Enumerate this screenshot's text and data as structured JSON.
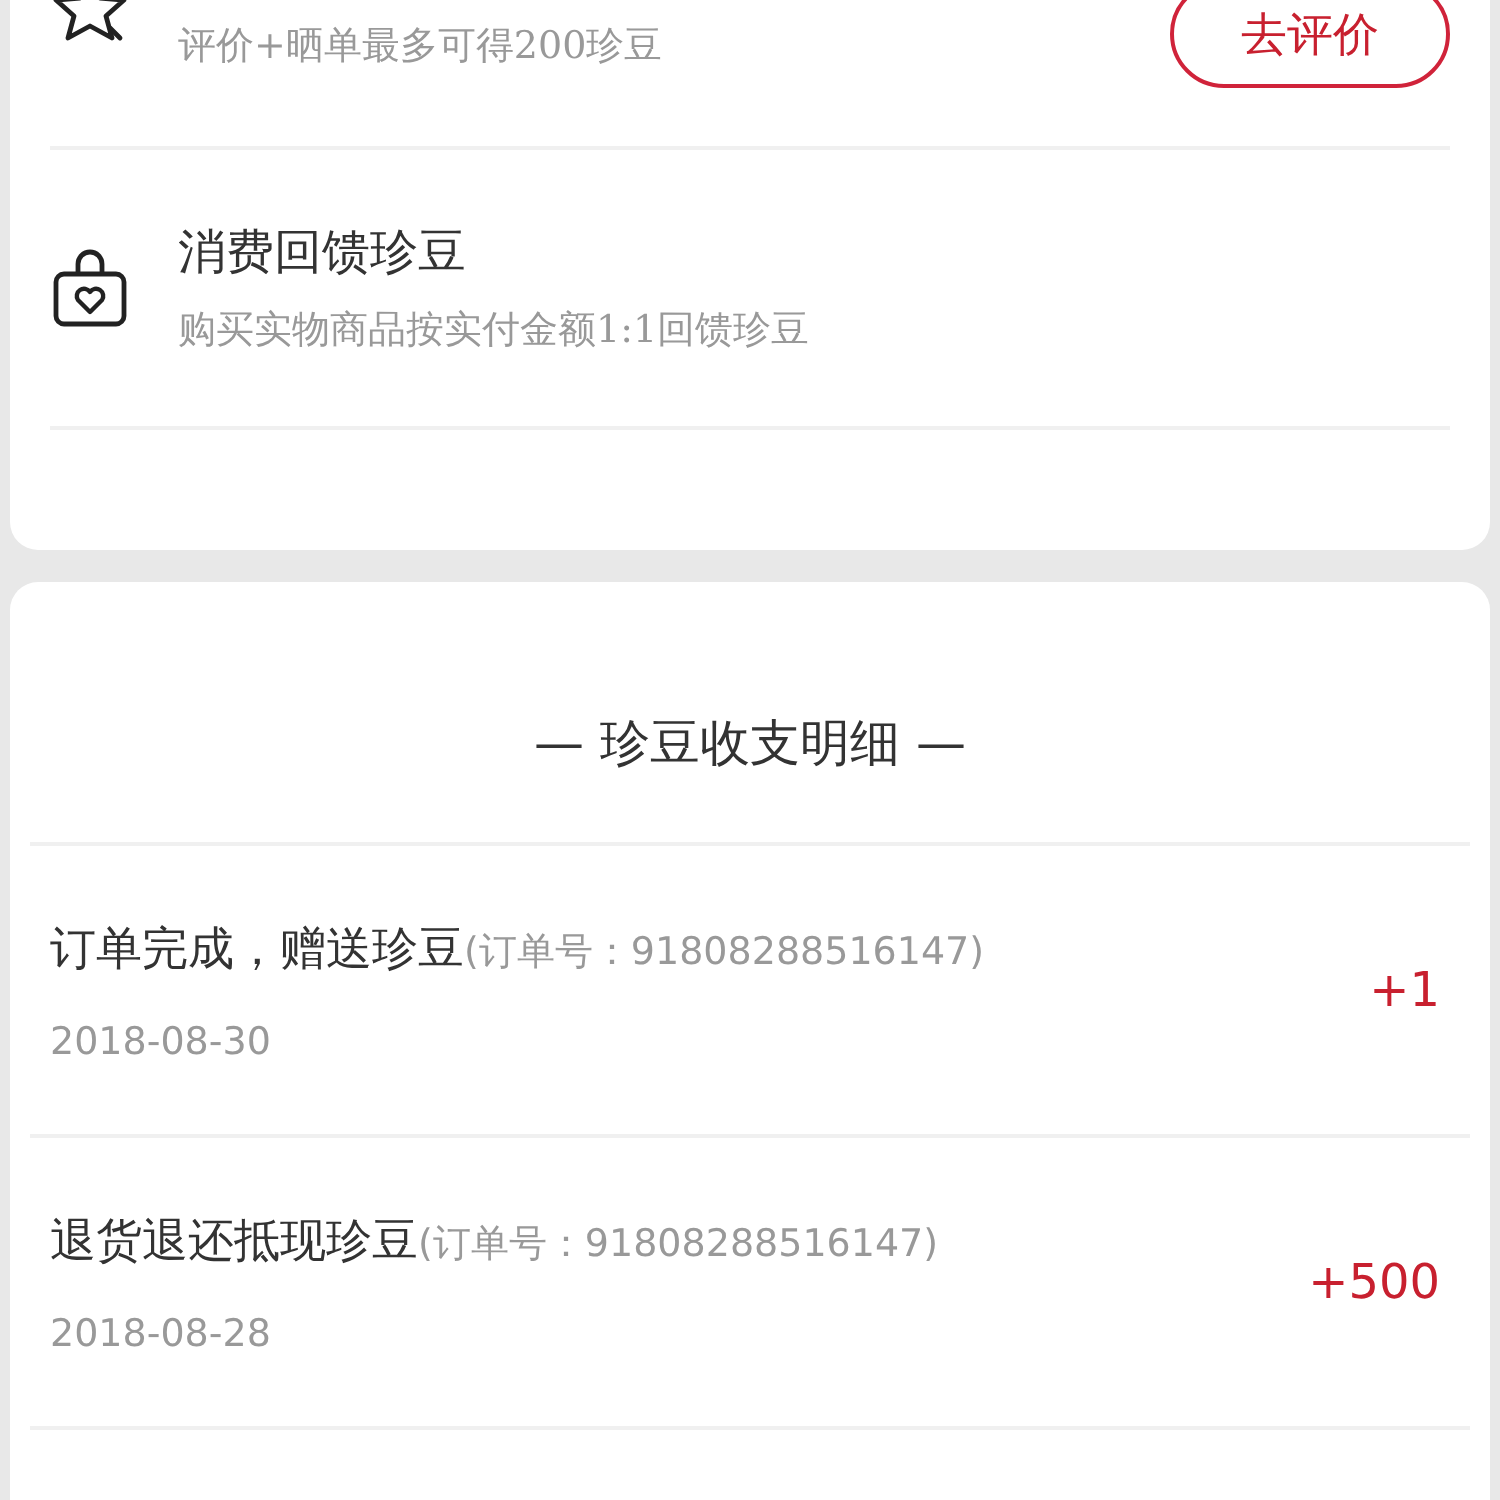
{
  "tasks": [
    {
      "kind": "review",
      "subtitle": "评价+晒单最多可得200珍豆",
      "button": "去评价"
    },
    {
      "kind": "purchase",
      "title": "消费回馈珍豆",
      "subtitle": "购买实物商品按实付金额1:1回馈珍豆"
    }
  ],
  "ledger": {
    "heading": "— 珍豆收支明细 —",
    "entries": [
      {
        "title": "订单完成，赠送珍豆",
        "order": "(订单号：91808288516147)",
        "date": "2018-08-30",
        "amount": "+1"
      },
      {
        "title": "退货退还抵现珍豆",
        "order": "(订单号：91808288516147)",
        "date": "2018-08-28",
        "amount": "+500"
      }
    ]
  }
}
